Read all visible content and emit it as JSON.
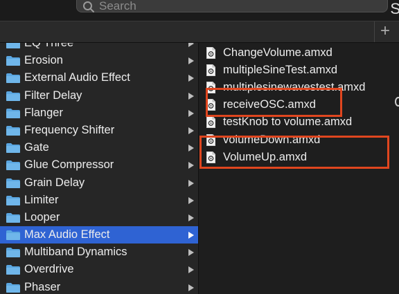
{
  "search": {
    "placeholder": "Search"
  },
  "toolbar": {
    "add_label": "+"
  },
  "folders": [
    {
      "label": "EQ Three"
    },
    {
      "label": "Erosion"
    },
    {
      "label": "External Audio Effect"
    },
    {
      "label": "Filter Delay"
    },
    {
      "label": "Flanger"
    },
    {
      "label": "Frequency Shifter"
    },
    {
      "label": "Gate"
    },
    {
      "label": "Glue Compressor"
    },
    {
      "label": "Grain Delay"
    },
    {
      "label": "Limiter"
    },
    {
      "label": "Looper"
    },
    {
      "label": "Max Audio Effect",
      "selected": true
    },
    {
      "label": "Multiband Dynamics"
    },
    {
      "label": "Overdrive"
    },
    {
      "label": "Phaser"
    }
  ],
  "files": [
    {
      "label": "ChangeVolume.amxd"
    },
    {
      "label": "multipleSineTest.amxd"
    },
    {
      "label": "multiplesinewavestest.amxd"
    },
    {
      "label": "receiveOSC.amxd"
    },
    {
      "label": "testKnob to volume.amxd"
    },
    {
      "label": "volumeDown.amxd"
    },
    {
      "label": "VolumeUp.amxd"
    }
  ],
  "colors": {
    "selection": "#2f63d3",
    "folder_icon": "#5aa6e0",
    "annotation": "#e0461f"
  },
  "icons": {
    "search": "search-icon",
    "folder": "folder-icon",
    "file": "max-device-file-icon",
    "chevron": "chevron-right-icon",
    "add": "plus-icon"
  }
}
